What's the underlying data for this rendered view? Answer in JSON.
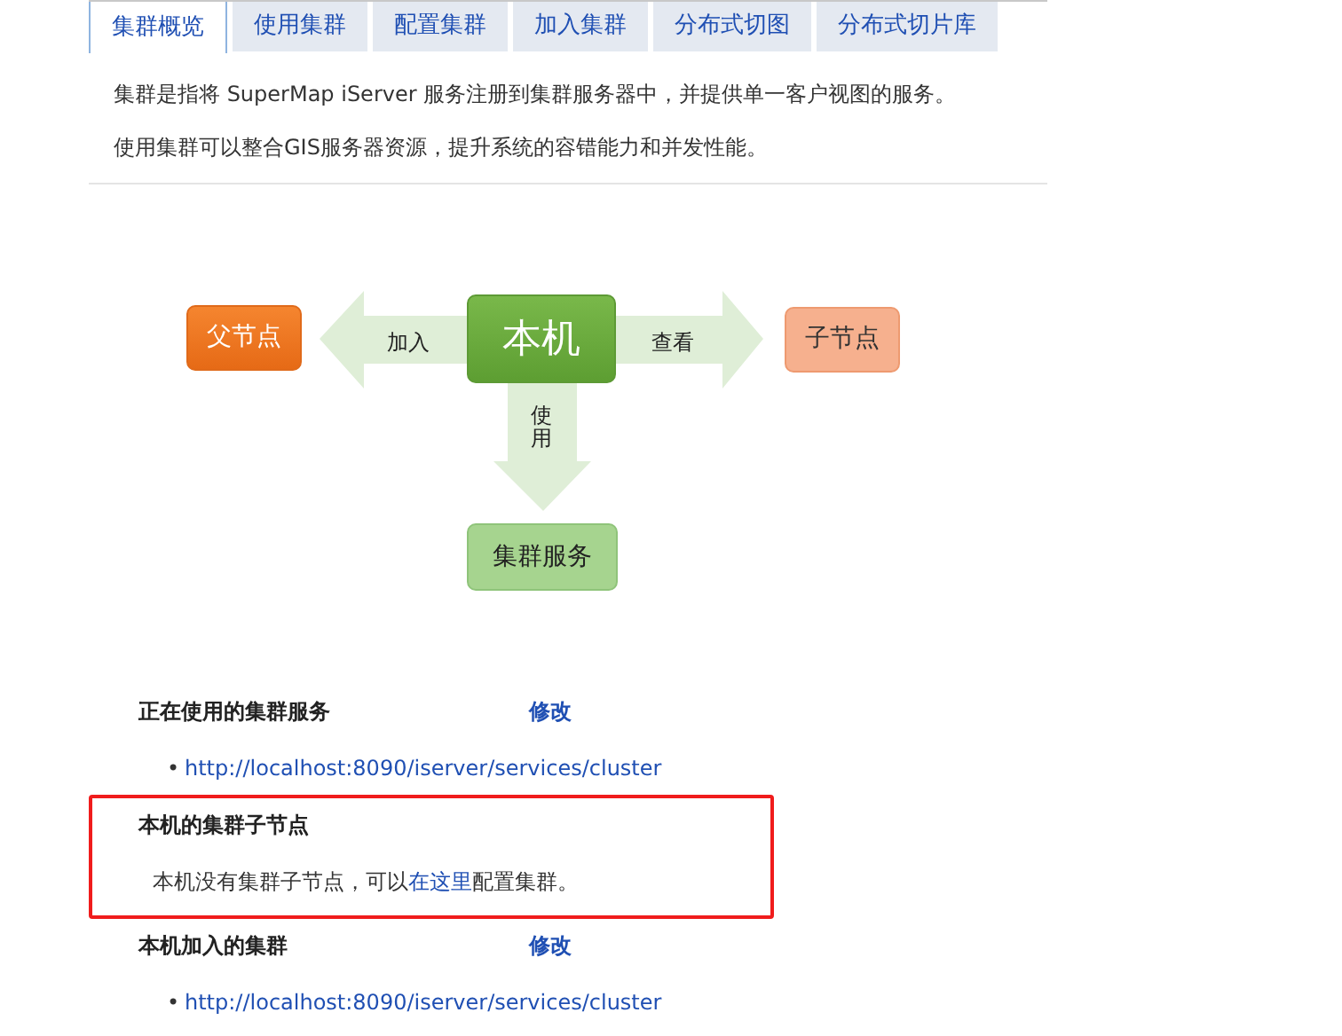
{
  "tabs": [
    {
      "label": "集群概览",
      "selected": true
    },
    {
      "label": "使用集群",
      "selected": false
    },
    {
      "label": "配置集群",
      "selected": false
    },
    {
      "label": "加入集群",
      "selected": false
    },
    {
      "label": "分布式切图",
      "selected": false
    },
    {
      "label": "分布式切片库",
      "selected": false
    }
  ],
  "intro": [
    "集群是指将 SuperMap iServer 服务注册到集群服务器中，并提供单一客户视图的服务。",
    "使用集群可以整合GIS服务器资源，提升系统的容错能力和并发性能。"
  ],
  "diagram": {
    "center": "本机",
    "parent": "父节点",
    "child": "子节点",
    "service": "集群服务",
    "join_label": "加入",
    "view_label": "查看",
    "use_label": "使用"
  },
  "sections": [
    {
      "kind": "links",
      "title": "正在使用的集群服务",
      "action": "修改",
      "bullet": "•",
      "links": [
        "http://localhost:8090/iserver/services/cluster"
      ],
      "highlighted": false
    },
    {
      "kind": "message",
      "title": "本机的集群子节点",
      "message": {
        "before": "本机没有集群子节点，可以",
        "link": "在这里",
        "after": "配置集群。"
      },
      "highlighted": true
    },
    {
      "kind": "links",
      "title": "本机加入的集群",
      "action": "修改",
      "bullet": "•",
      "links": [
        "http://localhost:8090/iserver/services/cluster"
      ],
      "highlighted": false
    }
  ]
}
